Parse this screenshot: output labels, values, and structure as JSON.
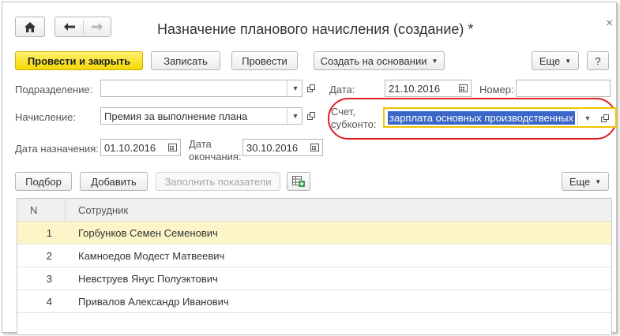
{
  "window": {
    "title": "Назначение планового начисления (создание) *",
    "close_glyph": "×"
  },
  "toolbar": {
    "post_close": "Провести и закрыть",
    "save": "Записать",
    "post": "Провести",
    "create_based": "Создать на основании",
    "more": "Еще",
    "help": "?"
  },
  "form": {
    "department_label": "Подразделение:",
    "department_value": "",
    "date_label": "Дата:",
    "date_value": "21.10.2016",
    "number_label": "Номер:",
    "number_value": "",
    "accrual_label": "Начисление:",
    "accrual_value": "Премия за выполнение плана",
    "account_label_1": "Счет,",
    "account_label_2": "субконто:",
    "account_value": "зарплата основных производственных",
    "assign_date_label": "Дата назначения:",
    "assign_date_value": "01.10.2016",
    "end_date_label_1": "Дата",
    "end_date_label_2": "окончания:",
    "end_date_value": "30.10.2016"
  },
  "table_toolbar": {
    "pick": "Подбор",
    "add": "Добавить",
    "fill": "Заполнить показатели",
    "more": "Еще"
  },
  "table": {
    "columns": [
      "N",
      "Сотрудник"
    ],
    "rows": [
      {
        "n": "1",
        "name": "Горбунков Семен Семенович"
      },
      {
        "n": "2",
        "name": "Камноедов Модест Матвеевич"
      },
      {
        "n": "3",
        "name": "Невструев Янус Полуэктович"
      },
      {
        "n": "4",
        "name": "Привалов Александр Иванович"
      }
    ]
  },
  "colors": {
    "primary_button": "#f5d800",
    "highlight_ring": "#e02020",
    "selected_row": "#fbf5c7",
    "selection": "#3a66c8"
  }
}
